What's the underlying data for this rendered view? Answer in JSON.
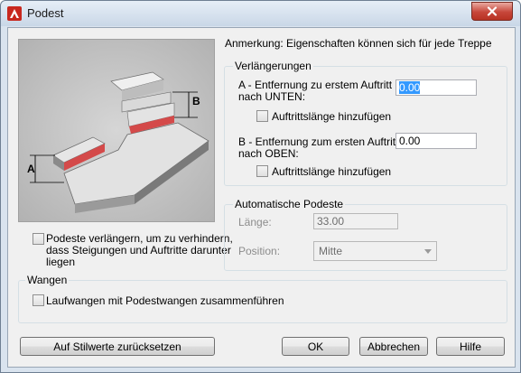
{
  "window": {
    "title": "Podest"
  },
  "illustration": {
    "label_a": "A",
    "label_b": "B"
  },
  "note": "Anmerkung: Eigenschaften können sich für jede Treppe",
  "verlaengerungen": {
    "legend": "Verlängerungen",
    "a_label_line1": "A - Entfernung zu erstem Auftritt",
    "a_label_line2": "nach UNTEN:",
    "a_value": "0.00",
    "a_checkbox": "Auftrittslänge hinzufügen",
    "b_label_line1": "B - Entfernung zum ersten Auftritt",
    "b_label_line2": "nach OBEN:",
    "b_value": "0.00",
    "b_checkbox": "Auftrittslänge hinzufügen"
  },
  "extend_checkbox": {
    "line1": "Podeste verlängern, um zu verhindern,",
    "line2": "dass Steigungen und Auftritte darunter",
    "line3": "liegen"
  },
  "auto_podeste": {
    "legend": "Automatische Podeste",
    "laenge_label": "Länge:",
    "laenge_value": "33.00",
    "position_label": "Position:",
    "position_value": "Mitte"
  },
  "wangen": {
    "legend": "Wangen",
    "checkbox": "Laufwangen mit Podestwangen zusammenführen"
  },
  "buttons": {
    "reset": "Auf Stilwerte zurücksetzen",
    "ok": "OK",
    "cancel": "Abbrechen",
    "help": "Hilfe"
  }
}
